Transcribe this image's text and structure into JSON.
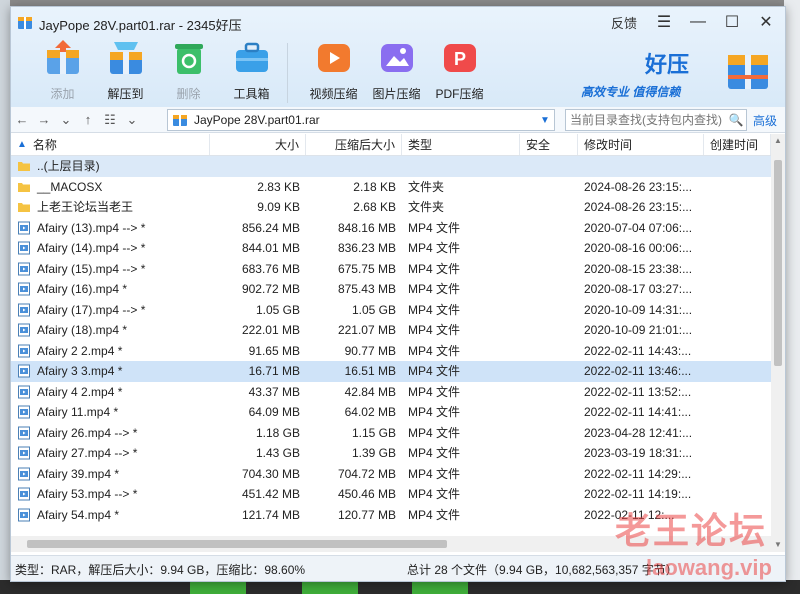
{
  "window": {
    "title": "JayPope 28V.part01.rar - 2345好压",
    "feedback": "反馈"
  },
  "toolbar": [
    {
      "label": "添加",
      "icon": "add-box-icon",
      "disabled": true
    },
    {
      "label": "解压到",
      "icon": "extract-box-icon",
      "disabled": false
    },
    {
      "label": "删除",
      "icon": "recycle-icon",
      "disabled": true
    },
    {
      "label": "工具箱",
      "icon": "toolbox-icon",
      "disabled": false
    },
    {
      "label": "视频压缩",
      "icon": "video-compress-icon",
      "disabled": false
    },
    {
      "label": "图片压缩",
      "icon": "image-compress-icon",
      "disabled": false
    },
    {
      "label": "PDF压缩",
      "icon": "pdf-compress-icon",
      "disabled": false
    }
  ],
  "brand": {
    "name": "好压",
    "slogan": "高效专业 值得信赖"
  },
  "nav": {
    "path": "JayPope 28V.part01.rar",
    "search_placeholder": "当前目录查找(支持包内查找)",
    "advanced": "高级"
  },
  "columns": {
    "name": "名称",
    "size": "大小",
    "compressed": "压缩后大小",
    "type": "类型",
    "security": "安全",
    "modified": "修改时间",
    "created": "创建时间"
  },
  "files": [
    {
      "name": "..(上层目录)",
      "kind": "folder",
      "size": "",
      "compressed": "",
      "type": "",
      "modified": ""
    },
    {
      "name": "__MACOSX",
      "kind": "folder",
      "size": "2.83 KB",
      "compressed": "2.18 KB",
      "type": "文件夹",
      "modified": "2024-08-26 23:15:..."
    },
    {
      "name": "上老王论坛当老王",
      "kind": "folder",
      "size": "9.09 KB",
      "compressed": "2.68 KB",
      "type": "文件夹",
      "modified": "2024-08-26 23:15:..."
    },
    {
      "name": "Afairy (13).mp4 --> *",
      "kind": "file",
      "size": "856.24 MB",
      "compressed": "848.16 MB",
      "type": "MP4 文件",
      "modified": "2020-07-04 07:06:..."
    },
    {
      "name": "Afairy (14).mp4 --> *",
      "kind": "file",
      "size": "844.01 MB",
      "compressed": "836.23 MB",
      "type": "MP4 文件",
      "modified": "2020-08-16 00:06:..."
    },
    {
      "name": "Afairy (15).mp4 --> *",
      "kind": "file",
      "size": "683.76 MB",
      "compressed": "675.75 MB",
      "type": "MP4 文件",
      "modified": "2020-08-15 23:38:..."
    },
    {
      "name": "Afairy (16).mp4 *",
      "kind": "file",
      "size": "902.72 MB",
      "compressed": "875.43 MB",
      "type": "MP4 文件",
      "modified": "2020-08-17 03:27:..."
    },
    {
      "name": "Afairy (17).mp4 --> *",
      "kind": "file",
      "size": "1.05 GB",
      "compressed": "1.05 GB",
      "type": "MP4 文件",
      "modified": "2020-10-09 14:31:..."
    },
    {
      "name": "Afairy (18).mp4 *",
      "kind": "file",
      "size": "222.01 MB",
      "compressed": "221.07 MB",
      "type": "MP4 文件",
      "modified": "2020-10-09 21:01:..."
    },
    {
      "name": "Afairy 2 2.mp4 *",
      "kind": "file",
      "size": "91.65 MB",
      "compressed": "90.77 MB",
      "type": "MP4 文件",
      "modified": "2022-02-11 14:43:..."
    },
    {
      "name": "Afairy 3 3.mp4 *",
      "kind": "file",
      "size": "16.71 MB",
      "compressed": "16.51 MB",
      "type": "MP4 文件",
      "modified": "2022-02-11 13:46:..."
    },
    {
      "name": "Afairy 4 2.mp4 *",
      "kind": "file",
      "size": "43.37 MB",
      "compressed": "42.84 MB",
      "type": "MP4 文件",
      "modified": "2022-02-11 13:52:..."
    },
    {
      "name": "Afairy 11.mp4 *",
      "kind": "file",
      "size": "64.09 MB",
      "compressed": "64.02 MB",
      "type": "MP4 文件",
      "modified": "2022-02-11 14:41:..."
    },
    {
      "name": "Afairy 26.mp4 --> *",
      "kind": "file",
      "size": "1.18 GB",
      "compressed": "1.15 GB",
      "type": "MP4 文件",
      "modified": "2023-04-28 12:41:..."
    },
    {
      "name": "Afairy 27.mp4 --> *",
      "kind": "file",
      "size": "1.43 GB",
      "compressed": "1.39 GB",
      "type": "MP4 文件",
      "modified": "2023-03-19 18:31:..."
    },
    {
      "name": "Afairy 39.mp4 *",
      "kind": "file",
      "size": "704.30 MB",
      "compressed": "704.72 MB",
      "type": "MP4 文件",
      "modified": "2022-02-11 14:29:..."
    },
    {
      "name": "Afairy 53.mp4 --> *",
      "kind": "file",
      "size": "451.42 MB",
      "compressed": "450.46 MB",
      "type": "MP4 文件",
      "modified": "2022-02-11 14:19:..."
    },
    {
      "name": "Afairy 54.mp4 *",
      "kind": "file",
      "size": "121.74 MB",
      "compressed": "120.77 MB",
      "type": "MP4 文件",
      "modified": "2022-02-11 12:..."
    }
  ],
  "status": {
    "left": "类型：RAR，解压后大小：9.94 GB，压缩比：98.60%",
    "right": "总计 28 个文件（9.94 GB，10,682,563,357 字节）"
  },
  "watermark": {
    "line1": "老王论坛",
    "line2": "laowang.vip"
  },
  "colors": {
    "accent": "#1a6fd6",
    "selected_row": "#dbe9f8",
    "folder": "#f5c342",
    "watermark": "#eb4646"
  }
}
